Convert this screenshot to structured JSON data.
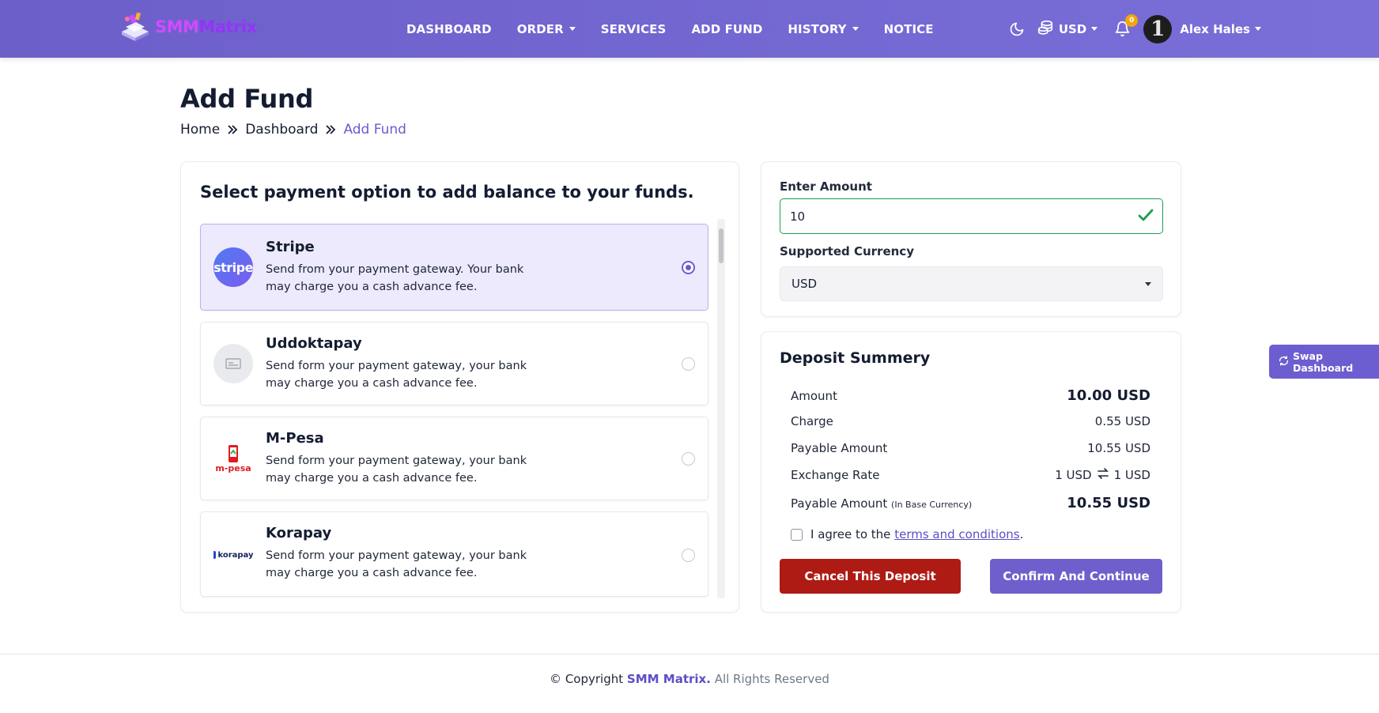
{
  "brand": {
    "logo_text_1": "SMM",
    "logo_text_2": "Matrix"
  },
  "nav": {
    "items": [
      {
        "label": "DASHBOARD",
        "dropdown": false
      },
      {
        "label": "ORDER",
        "dropdown": true
      },
      {
        "label": "SERVICES",
        "dropdown": false
      },
      {
        "label": "ADD FUND",
        "dropdown": false
      },
      {
        "label": "HISTORY",
        "dropdown": true
      },
      {
        "label": "NOTICE",
        "dropdown": false
      }
    ],
    "currency": "USD",
    "notification_count": "0",
    "avatar_text": "1",
    "user_name": "Alex Hales",
    "icons": [
      "moon-icon",
      "coins-icon",
      "bell-icon"
    ]
  },
  "page": {
    "title": "Add Fund",
    "breadcrumb": [
      "Home",
      "Dashboard",
      "Add Fund"
    ]
  },
  "payment": {
    "heading": "Select payment option to add balance to your funds.",
    "gateways": [
      {
        "name": "Stripe",
        "description": "Send from your payment gateway. Your bank may charge you a cash advance fee.",
        "selected": true,
        "logo_text": "stripe"
      },
      {
        "name": "Uddoktapay",
        "description": "Send form your payment gateway, your bank may charge you a cash advance fee.",
        "selected": false,
        "logo_text": ""
      },
      {
        "name": "M-Pesa",
        "description": "Send form your payment gateway, your bank may charge you a cash advance fee.",
        "selected": false,
        "logo_text": "m-pesa"
      },
      {
        "name": "Korapay",
        "description": "Send form your payment gateway, your bank may charge you a cash advance fee.",
        "selected": false,
        "logo_text": "korapay"
      }
    ]
  },
  "amount_form": {
    "amount_label": "Enter Amount",
    "amount_value": "10",
    "currency_label": "Supported Currency",
    "currency_value": "USD"
  },
  "summary": {
    "title": "Deposit Summery",
    "amount_label": "Amount",
    "amount_value": "10.00 USD",
    "charge_label": "Charge",
    "charge_value": "0.55 USD",
    "payable_label": "Payable Amount",
    "payable_value": "10.55 USD",
    "rate_label": "Exchange Rate",
    "rate_from": "1 USD",
    "rate_to": "1 USD",
    "base_label": "Payable Amount",
    "base_note": "(In Base Currency)",
    "base_value": "10.55 USD",
    "agree_prefix": "I agree to the",
    "agree_link": "terms and conditions",
    "agree_suffix": ".",
    "cancel_label": "Cancel This Deposit",
    "confirm_label": "Confirm And Continue"
  },
  "swap": {
    "label": "Swap Dashboard"
  },
  "footer": {
    "prefix": "© Copyright",
    "brand": "SMM Matrix.",
    "suffix": "All Rights Reserved"
  },
  "colors": {
    "accent": "#6c5dd3",
    "nav_bg": "#7468d3",
    "success": "#1e9e4f",
    "danger": "#ad1b14"
  }
}
